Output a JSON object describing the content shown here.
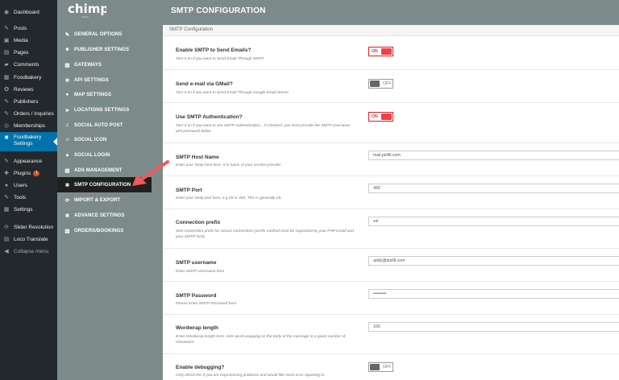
{
  "wp_menu": [
    {
      "label": "Dashboard",
      "icon": "dashboard-icon"
    },
    {
      "label": "Posts",
      "icon": "pin-icon"
    },
    {
      "label": "Media",
      "icon": "media-icon"
    },
    {
      "label": "Pages",
      "icon": "page-icon"
    },
    {
      "label": "Comments",
      "icon": "comment-icon"
    },
    {
      "label": "Foodbakery",
      "icon": "foodbakery-icon"
    },
    {
      "label": "Reviews",
      "icon": "reviews-icon"
    },
    {
      "label": "Publishers",
      "icon": "publishers-icon"
    },
    {
      "label": "Orders / Inquiries",
      "icon": "orders-icon"
    },
    {
      "label": "Memberships",
      "icon": "memberships-icon"
    },
    {
      "label": "Foodbakery Settings",
      "icon": "settings-icon"
    },
    {
      "label": "Appearance",
      "icon": "appearance-icon"
    },
    {
      "label": "Plugins",
      "icon": "plugins-icon",
      "badge": "1"
    },
    {
      "label": "Users",
      "icon": "users-icon"
    },
    {
      "label": "Tools",
      "icon": "tools-icon"
    },
    {
      "label": "Settings",
      "icon": "settings-icon"
    },
    {
      "label": "Slider Revolution",
      "icon": "slider-icon"
    },
    {
      "label": "Loco Translate",
      "icon": "translate-icon"
    },
    {
      "label": "Collapse menu",
      "icon": "collapse-icon"
    }
  ],
  "logo": {
    "text": "chimp",
    "tagline": "chimp"
  },
  "options_menu": [
    {
      "label": "General Options",
      "icon": "wrench-icon"
    },
    {
      "label": "Publisher Settings",
      "icon": "publisher-icon"
    },
    {
      "label": "Gateways",
      "icon": "gateway-icon"
    },
    {
      "label": "API Settings",
      "icon": "api-icon"
    },
    {
      "label": "Map Settings",
      "icon": "map-pin-icon"
    },
    {
      "label": "Locations Settings",
      "icon": "location-arrow-icon"
    },
    {
      "label": "Social Auto Post",
      "icon": "social-post-icon"
    },
    {
      "label": "Social Icon",
      "icon": "social-icon"
    },
    {
      "label": "Social Login",
      "icon": "lock-icon"
    },
    {
      "label": "Ads Management",
      "icon": "ads-icon"
    },
    {
      "label": "SMTP Configuration",
      "icon": "gear-icon"
    },
    {
      "label": "Import & Export",
      "icon": "refresh-icon"
    },
    {
      "label": "Advance Settings",
      "icon": "gear-icon"
    },
    {
      "label": "Orders/Bookings",
      "icon": "orders-icon"
    }
  ],
  "header": {
    "title": "SMTP CONFIGURATION",
    "subheader": "SMTP Configuration"
  },
  "fields": [
    {
      "label": "Enable SMTP to Send Emails?",
      "desc": "Turn it on if you want to Send Email Through SMTP.",
      "type": "toggle",
      "state": "on",
      "state_text": "ON"
    },
    {
      "label": "Send e-mail via GMail?",
      "desc": "Turn it on if you want to Send Email Through Google Email Server.",
      "type": "toggle",
      "state": "off",
      "state_text": "OFF"
    },
    {
      "label": "Use SMTP Authentication?",
      "desc": "Turn it on if you want to use SMTP Authentication... If checked, you must provide the SMTP username and password below",
      "type": "toggle",
      "state": "on",
      "state_text": "ON"
    },
    {
      "label": "SMTP Host Name",
      "desc": "Enter your Smtp host here, It is name of your service provider",
      "type": "text",
      "value": "mail.pixfill.com"
    },
    {
      "label": "SMTP Port",
      "desc": "Enter your Smtp port here, e.g 25 or 465, This is generally 25.",
      "type": "text",
      "value": "465"
    },
    {
      "label": "Connection prefix",
      "desc": "Sets connection prefix for secure connections (prefix method must be supported by your PHP install and your SMTP host)",
      "type": "text",
      "value": "ssl"
    },
    {
      "label": "SMTP username",
      "desc": "Enter SMTP Username here",
      "type": "text",
      "value": "addy@pixfill.com"
    },
    {
      "label": "SMTP Password",
      "desc": "Please Enter SMTP Password here",
      "type": "password",
      "value": "•••••••••"
    },
    {
      "label": "Wordwrap length",
      "desc": "Enter Wordwrap length here, Sets word wrapping on the body of the message to a given number of characters.",
      "type": "text",
      "value": "100"
    },
    {
      "label": "Enable debugging?",
      "desc": "Only check this if you are experiencing problems and would like more error reporting to",
      "type": "toggle",
      "state": "off",
      "state_text": "OFF"
    }
  ],
  "colors": {
    "accent": "#0073aa",
    "annotation_arrow": "#ef5a5a",
    "toggle_on": "#ee4045"
  }
}
